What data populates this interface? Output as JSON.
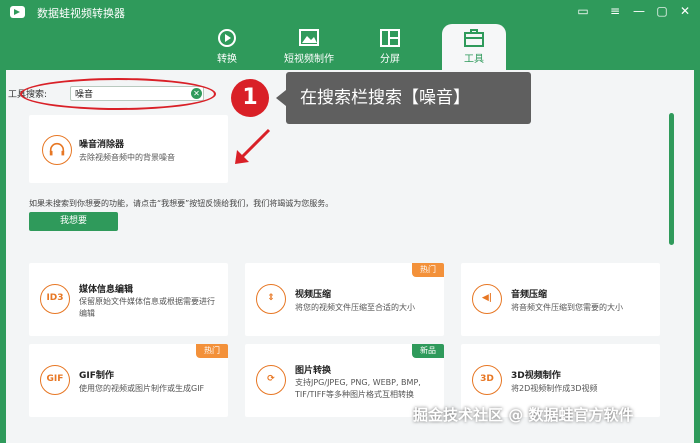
{
  "app": {
    "title": "数据蛙视频转换器"
  },
  "window_controls": [
    "message-icon",
    "menu-icon",
    "minimize-icon",
    "maximize-icon",
    "close-icon"
  ],
  "tabs": [
    {
      "label": "转换",
      "icon": "convert-icon"
    },
    {
      "label": "短视频制作",
      "icon": "short-video-icon"
    },
    {
      "label": "分屏",
      "icon": "split-screen-icon"
    },
    {
      "label": "工具",
      "icon": "toolbox-icon",
      "active": true
    }
  ],
  "search": {
    "label": "工具搜索:",
    "value": "噪音"
  },
  "annotation": {
    "step": "1",
    "text": "在搜索栏搜索【噪音】"
  },
  "result": {
    "title": "噪音消除器",
    "desc": "去除视频音频中的背景噪音",
    "icon": "headphones-noise-icon"
  },
  "hint": "如果未搜索到你想要的功能，请点击“我想要”按钮反馈给我们，我们将竭诚为您服务。",
  "want_button": "我想要",
  "tools": [
    {
      "title": "媒体信息编辑",
      "desc": "保留原始文件媒体信息或根据需要进行编辑",
      "icon_text": "ID3",
      "tag": ""
    },
    {
      "title": "视频压缩",
      "desc": "将您的视频文件压缩至合适的大小",
      "icon_text": "⇕",
      "tag": "热门"
    },
    {
      "title": "音频压缩",
      "desc": "将音频文件压缩到您需要的大小",
      "icon_text": "◀|",
      "tag": ""
    },
    {
      "title": "GIF制作",
      "desc": "使用您的视频或图片制作或生成GIF",
      "icon_text": "GIF",
      "tag": "热门"
    },
    {
      "title": "图片转换",
      "desc": "支持JPG/JPEG, PNG, WEBP, BMP, TIF/TIFF等多种图片格式互相转换",
      "icon_text": "⟳",
      "tag": "新品"
    },
    {
      "title": "3D视频制作",
      "desc": "将2D视频制作成3D视频",
      "icon_text": "3D",
      "tag": ""
    }
  ],
  "watermark": "掘金技术社区 @ 数据蛙官方软件",
  "colors": {
    "brand": "#2f9a5b",
    "accent": "#e77724",
    "hot": "#f3913a",
    "annotation": "#d92027"
  }
}
